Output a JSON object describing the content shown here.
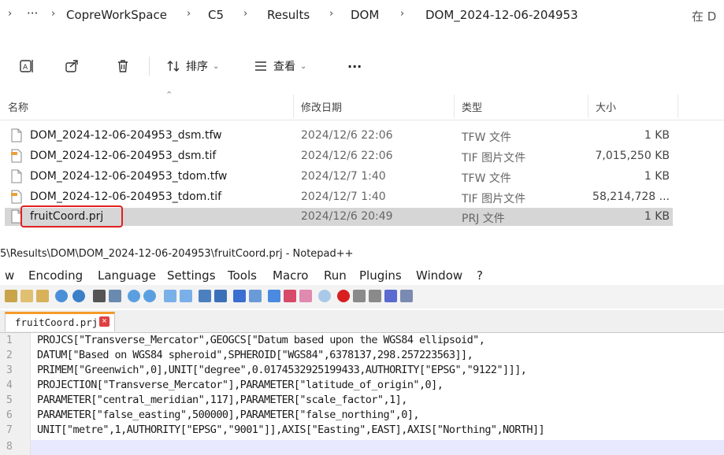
{
  "breadcrumb": {
    "items": [
      "CopreWorkSpace",
      "C5",
      "Results",
      "DOM",
      "DOM_2024-12-06-204953"
    ],
    "ellipsis": "···",
    "right_text": "在 D"
  },
  "toolbar": {
    "sort_label": "排序",
    "view_label": "查看",
    "more_label": "···"
  },
  "columns": {
    "name": "名称",
    "date": "修改日期",
    "type": "类型",
    "size": "大小"
  },
  "files": [
    {
      "name": "DOM_2024-12-06-204953_dsm.tfw",
      "date": "2024/12/6 22:06",
      "type": "TFW 文件",
      "size": "1 KB",
      "icon": "text-file-icon"
    },
    {
      "name": "DOM_2024-12-06-204953_dsm.tif",
      "date": "2024/12/6 22:06",
      "type": "TIF 图片文件",
      "size": "7,015,250 KB",
      "icon": "image-file-icon"
    },
    {
      "name": "DOM_2024-12-06-204953_tdom.tfw",
      "date": "2024/12/7 1:40",
      "type": "TFW 文件",
      "size": "1 KB",
      "icon": "text-file-icon"
    },
    {
      "name": "DOM_2024-12-06-204953_tdom.tif",
      "date": "2024/12/7 1:40",
      "type": "TIF 图片文件",
      "size": "58,214,728 ...",
      "icon": "image-file-icon"
    },
    {
      "name": "fruitCoord.prj",
      "date": "2024/12/6 20:49",
      "type": "PRJ 文件",
      "size": "1 KB",
      "icon": "text-file-icon",
      "selected": true
    }
  ],
  "notepad": {
    "title": "5\\Results\\DOM\\DOM_2024-12-06-204953\\fruitCoord.prj - Notepad++",
    "menu": [
      "w",
      "Encoding",
      "Language",
      "Settings",
      "Tools",
      "Macro",
      "Run",
      "Plugins",
      "Window",
      "?"
    ],
    "tab_label": "fruitCoord.prj",
    "lines": [
      "PROJCS[\"Transverse_Mercator\",GEOGCS[\"Datum based upon the WGS84 ellipsoid\",",
      "DATUM[\"Based on WGS84 spheroid\",SPHEROID[\"WGS84\",6378137,298.257223563]],",
      "PRIMEM[\"Greenwich\",0],UNIT[\"degree\",0.0174532925199433,AUTHORITY[\"EPSG\",\"9122\"]]],",
      "PROJECTION[\"Transverse_Mercator\"],PARAMETER[\"latitude_of_origin\",0],",
      "PARAMETER[\"central_meridian\",117],PARAMETER[\"scale_factor\",1],",
      "PARAMETER[\"false_easting\",500000],PARAMETER[\"false_northing\",0],",
      "UNIT[\"metre\",1,AUTHORITY[\"EPSG\",\"9001\"]],AXIS[\"Easting\",EAST],AXIS[\"Northing\",NORTH]]",
      ""
    ],
    "line_numbers": [
      "1",
      "2",
      "3",
      "4",
      "5",
      "6",
      "7",
      "8"
    ]
  },
  "colors": {
    "highlight": "#e02020",
    "tab_accent": "#f59a2a",
    "selected_row": "#d6d6d6"
  }
}
